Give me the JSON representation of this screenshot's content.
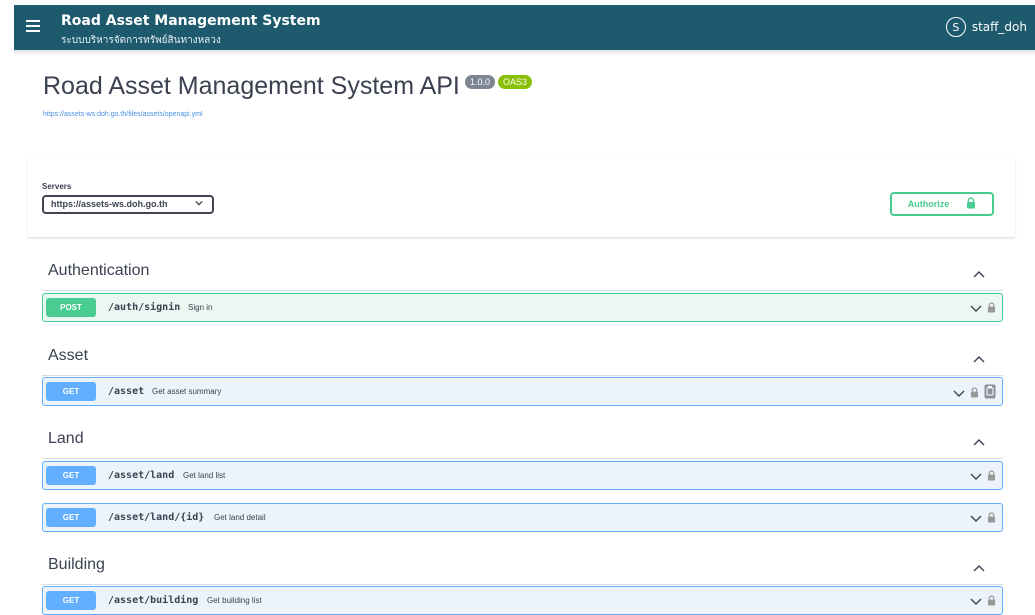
{
  "header": {
    "title": "Road Asset Management System",
    "subtitle": "ระบบบริหารจัดการทรัพย์สินทางหลวง",
    "user_initial": "S",
    "username": "staff_doh"
  },
  "info": {
    "title": "Road Asset Management System API",
    "version": "1.0.0",
    "oas": "OAS3",
    "spec_url": "https://assets-ws.doh.go.th/files/assets/openapi.yml"
  },
  "servers": {
    "label": "Servers",
    "selected": "https://assets-ws.doh.go.th"
  },
  "authorize": {
    "label": "Authorize"
  },
  "tags": [
    {
      "name": "Authentication",
      "operations": [
        {
          "method": "POST",
          "path": "/auth/signin",
          "summary": "Sign in"
        }
      ]
    },
    {
      "name": "Asset",
      "operations": [
        {
          "method": "GET",
          "path": "/asset",
          "summary": "Get asset summary"
        }
      ]
    },
    {
      "name": "Land",
      "operations": [
        {
          "method": "GET",
          "path": "/asset/land",
          "summary": "Get land list"
        },
        {
          "method": "GET",
          "path": "/asset/land/{id}",
          "summary": "Get land detail"
        }
      ]
    },
    {
      "name": "Building",
      "operations": [
        {
          "method": "GET",
          "path": "/asset/building",
          "summary": "Get building list"
        }
      ]
    }
  ],
  "icons": {
    "menu": "hamburger-icon",
    "expand": "chevron-down-icon",
    "collapse": "chevron-up-icon",
    "lock": "lock-icon",
    "copy": "copy-icon"
  },
  "colors": {
    "header_bg": "#1d5a6e",
    "post": "#49cc90",
    "get": "#61affe",
    "version_badge": "#7d8492",
    "oas_badge": "#89bf04"
  }
}
